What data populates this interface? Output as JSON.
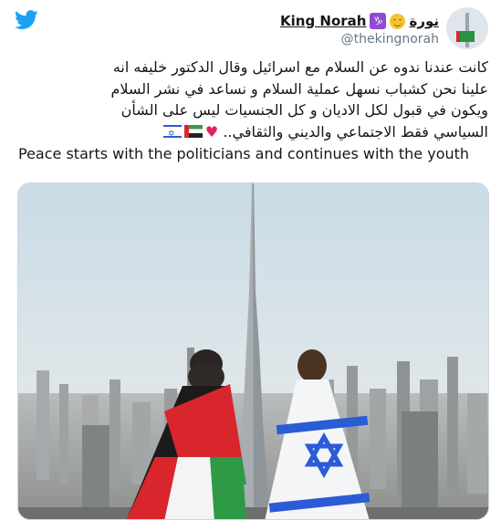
{
  "tweet": {
    "display_name": "King Norah",
    "display_name_arabic": "نورة",
    "zodiac_badge": "♑",
    "handle": "@thekingnorah",
    "text_arabic_lines": [
      "كانت عندنا ندوه عن السلام مع اسرائيل وقال الدكتور خليفه انه",
      "علينا نحن كشباب نسهل عملية السلام و نساعد في نشر السلام",
      "ويكون في قبول لكل الاديان و كل الجنسيات ليس على الشأن",
      "السياسي فقط الاجتماعي والديني والثقافي.."
    ],
    "text_english": "Peace starts with the politicians and continues with the youth"
  },
  "icons": {
    "app_logo": "twitter-bird-icon",
    "zodiac": "capricorn-icon",
    "emoji": "relieved-face-icon",
    "heart": "red-heart-icon",
    "flag_uae": "uae-flag-icon",
    "flag_israel": "israel-flag-icon"
  },
  "colors": {
    "twitter_blue": "#1da1f2",
    "text": "#14171a",
    "secondary_text": "#657786",
    "heart": "#e0245e"
  }
}
